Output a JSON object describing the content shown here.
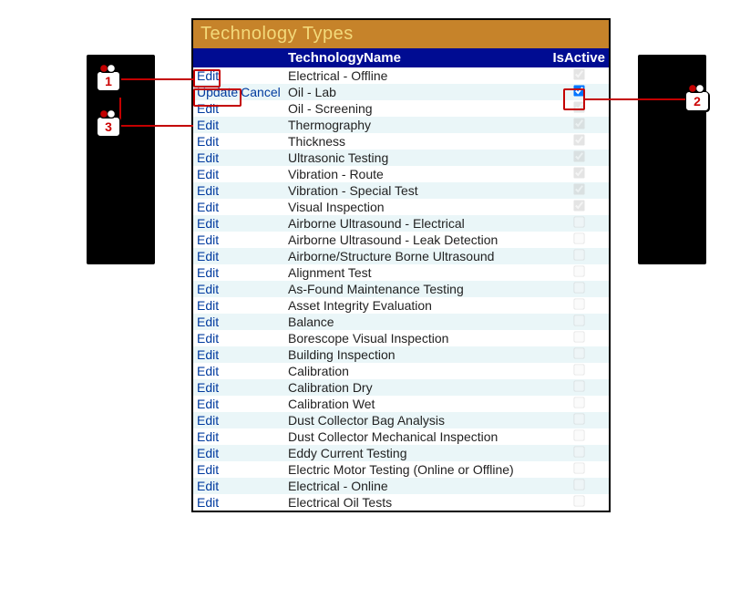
{
  "panel": {
    "title": "Technology Types"
  },
  "columns": {
    "action": "",
    "name": "TechnologyName",
    "active": "IsActive"
  },
  "labels": {
    "edit": "Edit",
    "update": "Update",
    "cancel": "Cancel"
  },
  "rows": [
    {
      "mode": "edit",
      "name": "Electrical - Offline",
      "active": true,
      "enabled": false
    },
    {
      "mode": "update",
      "name": "Oil - Lab",
      "active": true,
      "enabled": true
    },
    {
      "mode": "edit",
      "name": "Oil - Screening",
      "active": true,
      "enabled": false
    },
    {
      "mode": "edit",
      "name": "Thermography",
      "active": true,
      "enabled": false
    },
    {
      "mode": "edit",
      "name": "Thickness",
      "active": true,
      "enabled": false
    },
    {
      "mode": "edit",
      "name": "Ultrasonic Testing",
      "active": true,
      "enabled": false
    },
    {
      "mode": "edit",
      "name": "Vibration - Route",
      "active": true,
      "enabled": false
    },
    {
      "mode": "edit",
      "name": "Vibration - Special Test",
      "active": true,
      "enabled": false
    },
    {
      "mode": "edit",
      "name": "Visual Inspection",
      "active": true,
      "enabled": false
    },
    {
      "mode": "edit",
      "name": "Airborne Ultrasound - Electrical",
      "active": false,
      "enabled": false
    },
    {
      "mode": "edit",
      "name": "Airborne Ultrasound - Leak Detection",
      "active": false,
      "enabled": false
    },
    {
      "mode": "edit",
      "name": "Airborne/Structure Borne Ultrasound",
      "active": false,
      "enabled": false
    },
    {
      "mode": "edit",
      "name": "Alignment Test",
      "active": false,
      "enabled": false
    },
    {
      "mode": "edit",
      "name": "As-Found Maintenance Testing",
      "active": false,
      "enabled": false
    },
    {
      "mode": "edit",
      "name": "Asset Integrity Evaluation",
      "active": false,
      "enabled": false
    },
    {
      "mode": "edit",
      "name": "Balance",
      "active": false,
      "enabled": false
    },
    {
      "mode": "edit",
      "name": "Borescope Visual Inspection",
      "active": false,
      "enabled": false
    },
    {
      "mode": "edit",
      "name": "Building Inspection",
      "active": false,
      "enabled": false
    },
    {
      "mode": "edit",
      "name": "Calibration",
      "active": false,
      "enabled": false
    },
    {
      "mode": "edit",
      "name": "Calibration Dry",
      "active": false,
      "enabled": false
    },
    {
      "mode": "edit",
      "name": "Calibration Wet",
      "active": false,
      "enabled": false
    },
    {
      "mode": "edit",
      "name": "Dust Collector Bag Analysis",
      "active": false,
      "enabled": false
    },
    {
      "mode": "edit",
      "name": "Dust Collector Mechanical Inspection",
      "active": false,
      "enabled": false
    },
    {
      "mode": "edit",
      "name": "Eddy Current Testing",
      "active": false,
      "enabled": false
    },
    {
      "mode": "edit",
      "name": "Electric Motor Testing (Online or Offline)",
      "active": false,
      "enabled": false
    },
    {
      "mode": "edit",
      "name": "Electrical - Online",
      "active": false,
      "enabled": false
    },
    {
      "mode": "edit",
      "name": "Electrical Oil Tests",
      "active": false,
      "enabled": false
    }
  ],
  "callouts": {
    "1": "1",
    "2": "2",
    "3": "3"
  }
}
